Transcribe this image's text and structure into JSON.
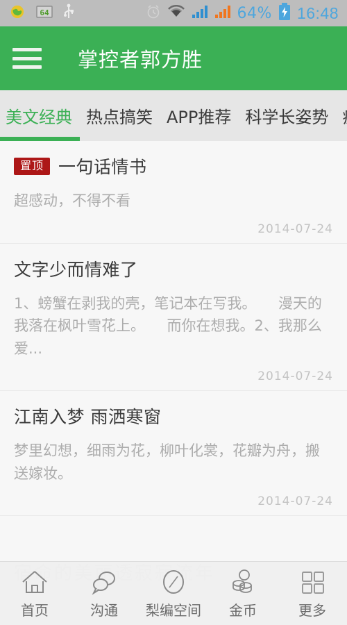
{
  "statusbar": {
    "battery_percent": "64%",
    "time": "16:48",
    "icons": [
      "globe-icon",
      "cpu-64-icon",
      "usb-icon",
      "alarm-icon",
      "wifi-icon",
      "signal-1-icon",
      "signal-2-icon",
      "battery-charging-icon"
    ]
  },
  "header": {
    "menu_icon": "hamburger-menu-icon",
    "title": "掌控者郭方胜"
  },
  "tabs": {
    "items": [
      {
        "label": "美文经典",
        "active": true
      },
      {
        "label": "热点搞笑",
        "active": false
      },
      {
        "label": "APP推荐",
        "active": false
      },
      {
        "label": "科学长姿势",
        "active": false
      },
      {
        "label": "疯",
        "active": false
      }
    ]
  },
  "list": {
    "items": [
      {
        "badge": "置顶",
        "title": "一句话情书",
        "desc": "超感动，不得不看",
        "date": "2014-07-24"
      },
      {
        "badge": "",
        "title": "文字少而情难了",
        "desc": "1、螃蟹在剥我的壳，笔记本在写我。　　漫天的我落在枫叶雪花上。　　而你在想我。2、我那么爱...",
        "date": "2014-07-24"
      },
      {
        "badge": "",
        "title": "江南入梦 雨洒寒窗",
        "desc": "梦里幻想，细雨为花，柳叶化裳，花瓣为舟，搬送嫁妆。",
        "date": "2014-07-24"
      }
    ]
  },
  "watermark": {
    "text": "宿命的美丽透寂寂流年"
  },
  "bottomnav": {
    "items": [
      {
        "label": "首页",
        "icon": "home-icon"
      },
      {
        "label": "沟通",
        "icon": "chat-bubbles-icon"
      },
      {
        "label": "梨编空间",
        "icon": "compass-icon"
      },
      {
        "label": "金币",
        "icon": "coins-icon"
      },
      {
        "label": "更多",
        "icon": "grid-more-icon"
      }
    ]
  },
  "colors": {
    "brand_green": "#3bb055",
    "badge_red": "#ad1717",
    "status_blue": "#4da6dd",
    "statusbar_bg": "#bdbdbd",
    "page_bg": "#f7f7f7",
    "tabbar_bg": "#e6e6e6"
  }
}
